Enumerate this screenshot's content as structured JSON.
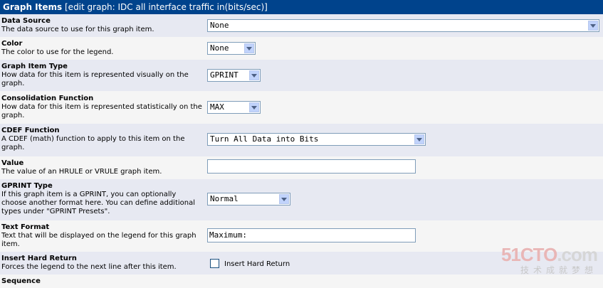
{
  "header": {
    "title": "Graph Items",
    "subtitle": "[edit graph: IDC all interface traffic in(bits/sec)]"
  },
  "fields": {
    "data_source": {
      "name": "Data Source",
      "desc": "The data source to use for this graph item.",
      "value": "None"
    },
    "color": {
      "name": "Color",
      "desc": "The color to use for the legend.",
      "value": "None"
    },
    "graph_item_type": {
      "name": "Graph Item Type",
      "desc": "How data for this item is represented visually on the graph.",
      "value": "GPRINT"
    },
    "consolidation_function": {
      "name": "Consolidation Function",
      "desc": "How data for this item is represented statistically on the graph.",
      "value": "MAX"
    },
    "cdef_function": {
      "name": "CDEF Function",
      "desc": "A CDEF (math) function to apply to this item on the graph.",
      "value": "Turn All Data into Bits"
    },
    "value": {
      "name": "Value",
      "desc": "The value of an HRULE or VRULE graph item.",
      "value": ""
    },
    "gprint_type": {
      "name": "GPRINT Type",
      "desc": "If this graph item is a GPRINT, you can optionally choose another format here. You can define additional types under \"GPRINT Presets\".",
      "value": "Normal"
    },
    "text_format": {
      "name": "Text Format",
      "desc": "Text that will be displayed on the legend for this graph item.",
      "value": "Maximum:"
    },
    "insert_hard_return": {
      "name": "Insert Hard Return",
      "desc": "Forces the legend to the next line after this item.",
      "checkbox_label": "Insert Hard Return",
      "checked": false
    },
    "sequence": {
      "name": "Sequence"
    }
  },
  "watermark": {
    "logo_prefix": "51CTO",
    "logo_suffix": ".com",
    "slogan": "技术成就梦想"
  },
  "icons": {
    "dropdown": "chevron-down-icon"
  },
  "colors": {
    "header_bg": "#00438c",
    "row_odd": "#e7e9f2",
    "row_even": "#f5f5f5"
  }
}
